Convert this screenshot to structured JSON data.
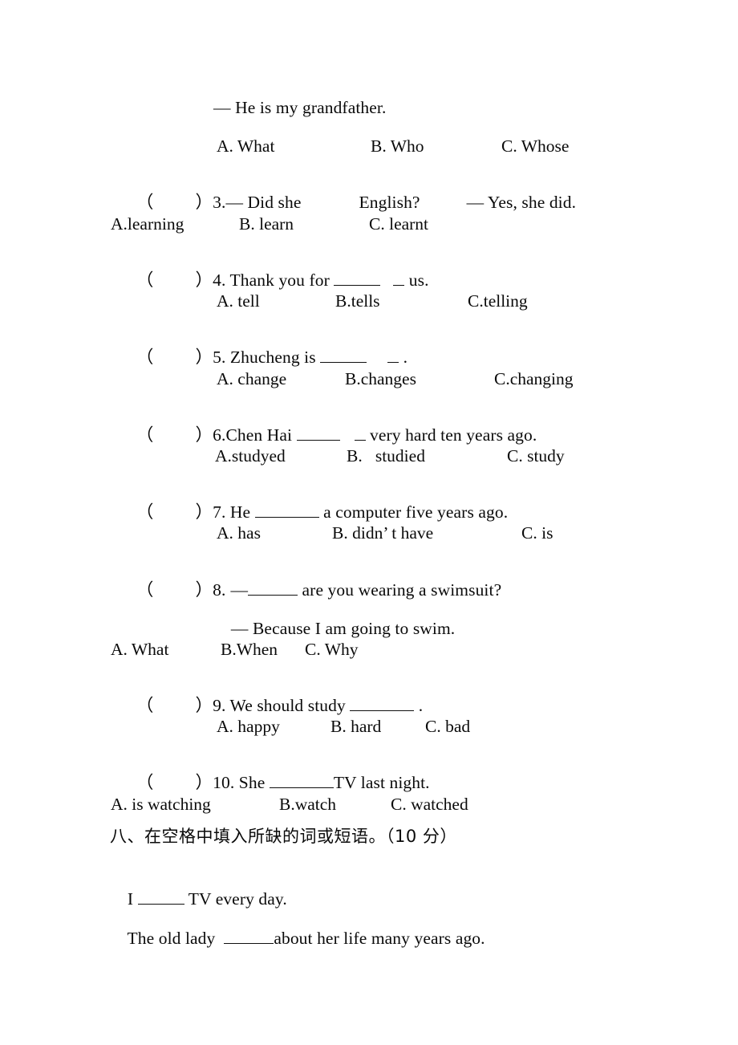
{
  "document": {
    "type": "printed-exam-worksheet",
    "language": "English with Chinese section heading"
  },
  "lines": {
    "answer_grandfather": "— He is my grandfather.",
    "q2_options": {
      "a": "A. What",
      "b": "B. Who",
      "c": "C. Whose"
    },
    "q3": {
      "open_paren": "（",
      "close_paren": "）",
      "number": "3.",
      "dash": "—",
      "stem_before": " Did she",
      "stem_after": "English?",
      "reply_dash": "—",
      "reply": " Yes, she did.",
      "options": {
        "a": "A.learning",
        "b": "B. learn",
        "c": "C. learnt"
      }
    },
    "q4": {
      "open_paren": "（",
      "close_paren": "）",
      "number": "4.",
      "stem_before": " Thank you for ",
      "stem_after": " us.",
      "options": {
        "a": "A. tell",
        "b": "B.tells",
        "c": "C.telling"
      }
    },
    "q5": {
      "open_paren": "（",
      "close_paren": "）",
      "number": "5.",
      "stem_before": " Zhucheng is ",
      "stem_after": " .",
      "options": {
        "a": "A. change",
        "b": "B.changes",
        "c": "C.changing"
      }
    },
    "q6": {
      "open_paren": "（",
      "close_paren": "）",
      "number": "6.",
      "stem_before": "Chen Hai ",
      "stem_after": " very hard ten years ago.",
      "options": {
        "a": "A.studyed",
        "b": "B.   studied",
        "c": "C. study"
      }
    },
    "q7": {
      "open_paren": "（",
      "close_paren": "）",
      "number": "7.",
      "stem_before": " He ",
      "stem_after": " a computer five years ago.",
      "options": {
        "a": "A. has",
        "b": "B. didn’ t have",
        "c": "C. is"
      }
    },
    "q8": {
      "open_paren": "（",
      "close_paren": "）",
      "number": "8.",
      "dash": "—",
      "stem_after": " are you wearing a swimsuit?",
      "reply_dash": "—",
      "reply": " Because I am going to swim.",
      "options": {
        "a": "A. What",
        "b": "B.When",
        "c": "C. Why"
      }
    },
    "q9": {
      "open_paren": "（",
      "close_paren": "）",
      "number": "9.",
      "stem_before": " We should study ",
      "stem_after": " .",
      "options": {
        "a": "A. happy",
        "b": "B. hard",
        "c": "C. bad"
      }
    },
    "q10": {
      "open_paren": "（",
      "close_paren": "）",
      "number": "10.",
      "stem_before": " She ",
      "stem_after": "TV last night.",
      "options": {
        "a": "A. is watching",
        "b": "B.watch",
        "c": "C. watched"
      }
    },
    "section_eight": {
      "heading": "八、在空格中填入所缺的词或短语。（10 分）",
      "item1_before": "I ",
      "item1_after": " TV every day.",
      "item2_before": "The old lady  ",
      "item2_after": "about her life many years ago."
    }
  }
}
